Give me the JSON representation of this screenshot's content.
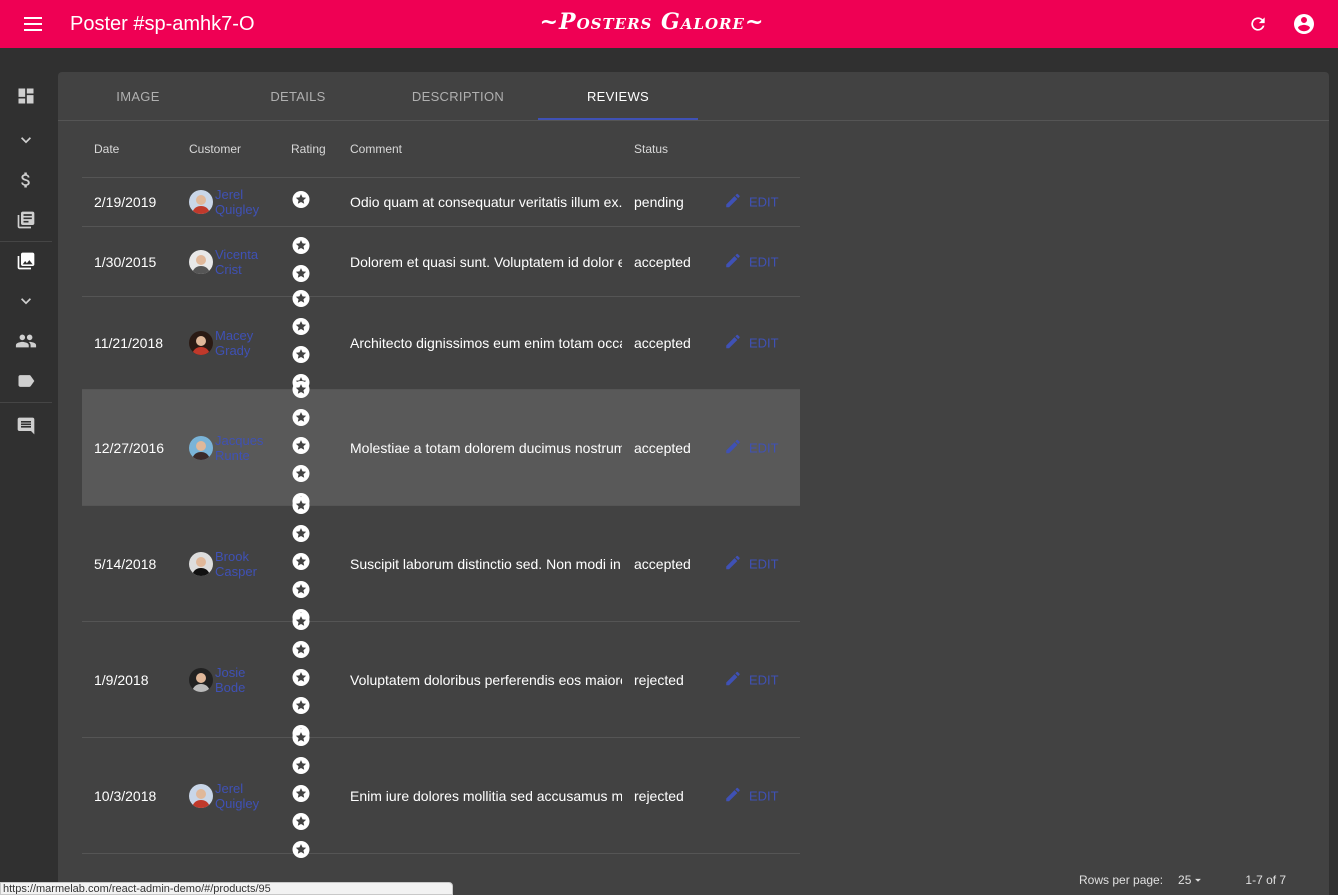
{
  "appbar": {
    "title": "Poster #sp-amhk7-O",
    "brand": "~Posters Galore~"
  },
  "tabs": [
    "IMAGE",
    "DETAILS",
    "DESCRIPTION",
    "REVIEWS"
  ],
  "active_tab": "REVIEWS",
  "table": {
    "headers": {
      "date": "Date",
      "customer": "Customer",
      "rating": "Rating",
      "comment": "Comment",
      "status": "Status"
    },
    "edit_label": "EDIT",
    "rows": [
      {
        "date": "2/19/2019",
        "customer": "Jerel Quigley",
        "rating": 1,
        "comment": "Odio quam at consequatur veritatis illum ex.",
        "status": "pending"
      },
      {
        "date": "1/30/2015",
        "customer": "Vicenta Crist",
        "rating": 2,
        "comment": "Dolorem et quasi sunt. Voluptatem id dolor e",
        "status": "accepted"
      },
      {
        "date": "11/21/2018",
        "customer": "Macey Grady",
        "rating": 4,
        "comment": "Architecto dignissimos eum enim totam occa",
        "status": "accepted"
      },
      {
        "date": "12/27/2016",
        "customer": "Jacques Runte",
        "rating": 5,
        "comment": "Molestiae a totam dolorem ducimus nostrum",
        "status": "accepted"
      },
      {
        "date": "5/14/2018",
        "customer": "Brook Casper",
        "rating": 5,
        "comment": "Suscipit laborum distinctio sed. Non modi in",
        "status": "accepted"
      },
      {
        "date": "1/9/2018",
        "customer": "Josie Bode",
        "rating": 5,
        "comment": "Voluptatem doloribus perferendis eos maiore",
        "status": "rejected"
      },
      {
        "date": "10/3/2018",
        "customer": "Jerel Quigley",
        "rating": 5,
        "comment": "Enim iure dolores mollitia sed accusamus m",
        "status": "rejected"
      }
    ]
  },
  "pagination": {
    "rows_per_page_label": "Rows per page:",
    "rows_per_page": "25",
    "range": "1-7 of 7"
  },
  "statusbar_url": "https://marmelab.com/react-admin-demo/#/products/95",
  "colors": {
    "appbar": "#ef0054",
    "accent": "#3f51b5",
    "background": "#303030",
    "card": "#424242"
  }
}
